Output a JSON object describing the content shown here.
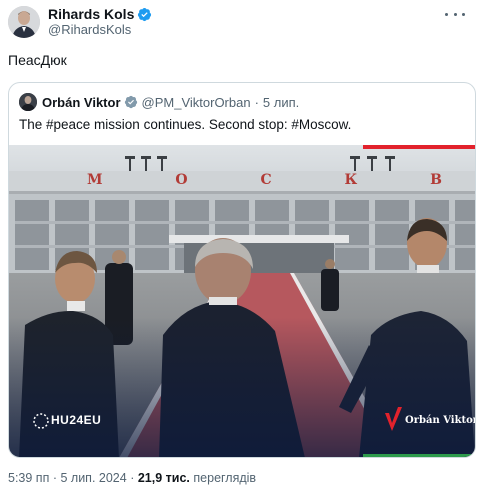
{
  "author": {
    "name": "Rihards Kols",
    "handle": "@RihardsKols",
    "avatar_icon": "avatar-photo",
    "verified_icon": "verified-badge-icon",
    "verified_color": "#1d9bf0"
  },
  "tweet": {
    "text": "ПеасДюк"
  },
  "quote": {
    "name": "Orbán Viktor",
    "handle": "@PM_ViktorOrban",
    "separator": "·",
    "time": "5 лип.",
    "text": "The #peace mission continues. Second stop: #Moscow.",
    "verified_color": "#829aab",
    "image": {
      "building_sign": "М О С К В А",
      "watermark_left": "HU24EU",
      "watermark_right": "Orbán Viktor",
      "accent_red": "#e2222c",
      "accent_green": "#2d9a4b"
    }
  },
  "meta": {
    "time": "5:39 пп",
    "separator": "·",
    "date": "5 лип. 2024",
    "separator2": "·",
    "views_count": "21,9 тис.",
    "views_label": "переглядів"
  }
}
